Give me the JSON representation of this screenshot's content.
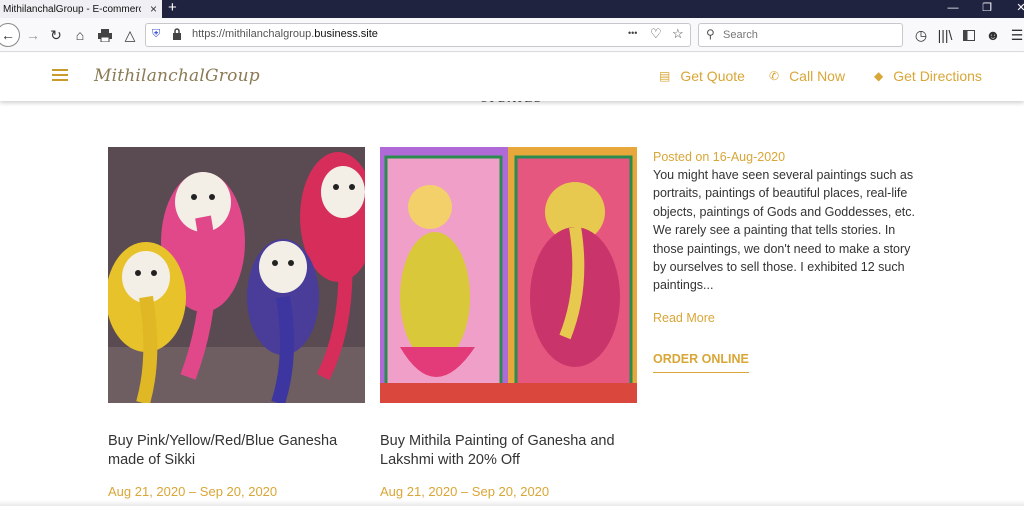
{
  "browser": {
    "tab_title": "MithilanchalGroup - E-commerce",
    "tab_close": "×",
    "new_tab": "+",
    "url_prefix": "https://mithilanchalgroup.",
    "url_domain": "business.site",
    "search_placeholder": "Search",
    "overflow_dots": "•••"
  },
  "header": {
    "brand": "MithilanchalGroup",
    "get_quote": "Get Quote",
    "call_now": "Call Now",
    "get_directions": "Get Directions"
  },
  "section": {
    "title": "UPDATES"
  },
  "cards": [
    {
      "title": "Buy Pink/Yellow/Red/Blue Ganesha made of Sikki",
      "date": "Aug 21, 2020 – Sep 20, 2020"
    },
    {
      "title": "Buy Mithila Painting of Ganesha and Lakshmi with 20% Off",
      "date": "Aug 21, 2020 – Sep 20, 2020"
    }
  ],
  "post": {
    "date": "Posted on 16-Aug-2020",
    "body": "You might have seen several paintings such as portraits, paintings of beautiful places, real-life objects, paintings of Gods and Goddesses, etc. We rarely see a painting that tells stories. In those paintings, we don't need to make a story by ourselves to sell those. I exhibited 12 such paintings...",
    "read_more": "Read More",
    "order_online": "ORDER ONLINE"
  },
  "colors": {
    "accent": "#d9a637",
    "tabbar": "#1f2340",
    "brand_text": "#8a7a55"
  },
  "icons": [
    "back-icon",
    "forward-icon",
    "reload-icon",
    "home-icon",
    "print-icon",
    "bookmark-up-icon",
    "shield-icon",
    "lock-icon",
    "pocket-icon",
    "star-icon",
    "search-icon",
    "history-icon",
    "library-icon",
    "sidebar-icon",
    "account-icon",
    "menu-icon",
    "hamburger-icon",
    "quote-icon",
    "phone-icon",
    "directions-icon"
  ]
}
